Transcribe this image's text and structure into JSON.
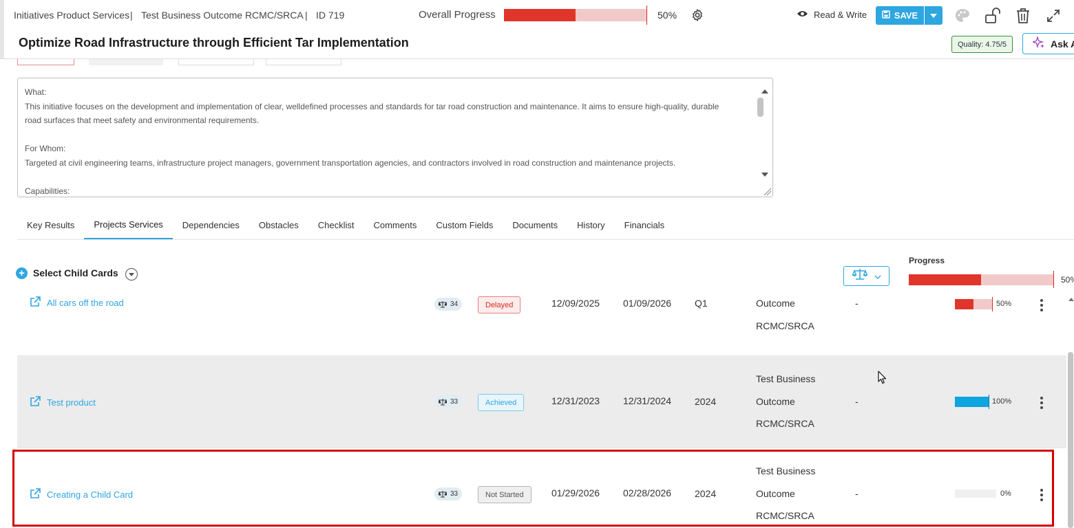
{
  "header": {
    "breadcrumb": {
      "parent": "Initiatives Product Services",
      "outcome": "Test Business Outcome RCMC/SRCA",
      "id": "ID 719",
      "sep": "|"
    },
    "overall_progress": {
      "label": "Overall Progress",
      "value_pct": 50,
      "text": "50%"
    },
    "access": {
      "label": "Read & Write"
    },
    "save": {
      "label": "SAVE"
    },
    "title": "Optimize Road Infrastructure through Efficient Tar Implementation",
    "quality": "Quality: 4.75/5",
    "ask": "Ask A"
  },
  "description": {
    "lines": [
      "What:",
      "This initiative focuses on the development and implementation of clear, welldefined processes and standards for tar road construction and maintenance. It aims to ensure high-quality, durable",
      "road surfaces that meet safety and environmental requirements.",
      "",
      "For Whom:",
      "Targeted at civil engineering teams, infrastructure project managers, government transportation agencies, and contractors involved in road construction and maintenance projects.",
      "",
      "Capabilities:"
    ]
  },
  "tabs": [
    {
      "label": "Key Results",
      "active": false
    },
    {
      "label": "Projects Services",
      "active": true
    },
    {
      "label": "Dependencies",
      "active": false
    },
    {
      "label": "Obstacles",
      "active": false
    },
    {
      "label": "Checklist",
      "active": false
    },
    {
      "label": "Comments",
      "active": false
    },
    {
      "label": "Custom Fields",
      "active": false
    },
    {
      "label": "Documents",
      "active": false
    },
    {
      "label": "History",
      "active": false
    },
    {
      "label": "Financials",
      "active": false
    }
  ],
  "children": {
    "select_label": "Select Child Cards",
    "progress": {
      "label": "Progress",
      "value_pct": 50,
      "text": "50%"
    },
    "rows": [
      {
        "name": "All cars off the road",
        "weight": "34",
        "status": "Delayed",
        "start": "12/09/2025",
        "end": "01/09/2026",
        "period": "Q1",
        "outcome": [
          "Outcome",
          "RCMC/SRCA"
        ],
        "dash": "-",
        "progress_pct": 50,
        "progress_text": "50%"
      },
      {
        "name": "Test product",
        "weight": "33",
        "status": "Achieved",
        "start": "12/31/2023",
        "end": "12/31/2024",
        "period": "2024",
        "outcome": [
          "Test Business",
          "Outcome",
          "RCMC/SRCA"
        ],
        "dash": "-",
        "progress_pct": 100,
        "progress_text": "100%"
      },
      {
        "name": "Creating a Child Card",
        "weight": "33",
        "status": "Not Started",
        "start": "01/29/2026",
        "end": "02/28/2026",
        "period": "2024",
        "outcome": [
          "Test Business",
          "Outcome",
          "RCMC/SRCA"
        ],
        "dash": "-",
        "progress_pct": 0,
        "progress_text": "0%"
      }
    ]
  },
  "colors": {
    "accent": "#2ea6e0",
    "progress_red": "#e0352b",
    "progress_track": "#f2c9c9",
    "progress_blue": "#0ea5e0",
    "highlight": "#d40000"
  }
}
